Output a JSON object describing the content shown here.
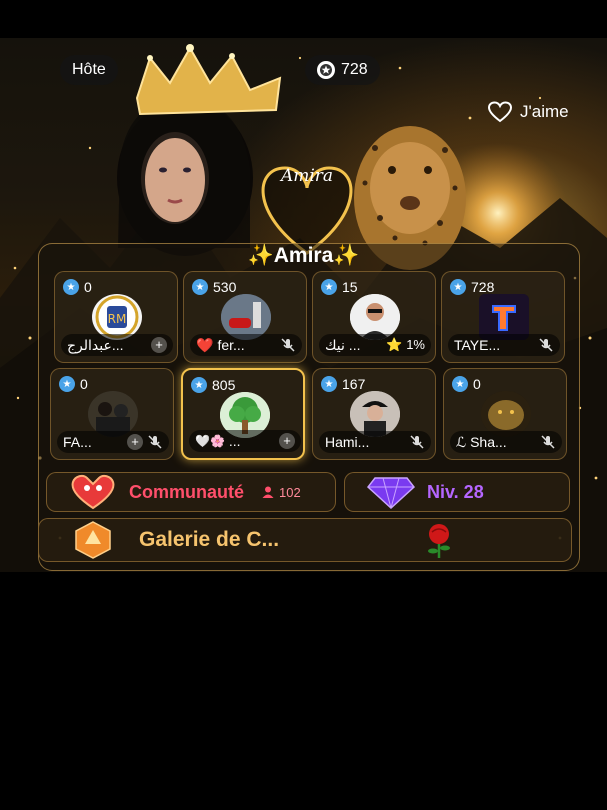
{
  "header": {
    "host_label": "Hôte",
    "coins": "728",
    "like_label": "J'aime"
  },
  "room": {
    "heart_name": "Amira",
    "title_spark_left": "✨",
    "title_name": "Amira",
    "title_spark_right": "✨"
  },
  "seats": [
    {
      "count": "0",
      "name": "عبدالرج...",
      "prefix": "",
      "suffix": "+",
      "muted": false,
      "avatar": "real-madrid-logo"
    },
    {
      "count": "530",
      "name": "fer...",
      "prefix": "❤️",
      "suffix": "",
      "muted": true,
      "avatar": "car-photo"
    },
    {
      "count": "15",
      "name": "نيك ...",
      "prefix": "",
      "suffix": "⭐ 1%",
      "muted": false,
      "avatar": "man-sunglasses"
    },
    {
      "count": "728",
      "name": "TAYE...",
      "prefix": "",
      "suffix": "",
      "muted": true,
      "avatar": "neon-letter"
    },
    {
      "count": "0",
      "name": "FA...",
      "prefix": "",
      "suffix": "+",
      "muted": true,
      "avatar": "couple-photo"
    },
    {
      "count": "805",
      "name": "...",
      "prefix": "🤍🌸",
      "suffix": "+",
      "muted": false,
      "avatar": "tree-cartoon"
    },
    {
      "count": "167",
      "name": "Hami...",
      "prefix": "",
      "suffix": "",
      "muted": true,
      "avatar": "woman-cap"
    },
    {
      "count": "0",
      "name": "Sha...",
      "prefix": "ℒ",
      "suffix": "",
      "muted": true,
      "avatar": "leopard-gold"
    }
  ],
  "community": {
    "label": "Communauté",
    "members": "102"
  },
  "level": {
    "label": "Niv. 28"
  },
  "gallery": {
    "label": "Galerie de C..."
  },
  "colors": {
    "gold": "#f3c24d",
    "community_red": "#ff4f6b",
    "level_purple": "#b566ff",
    "gallery_gold": "#f6c46e",
    "badge_blue": "#4aa3e8"
  }
}
